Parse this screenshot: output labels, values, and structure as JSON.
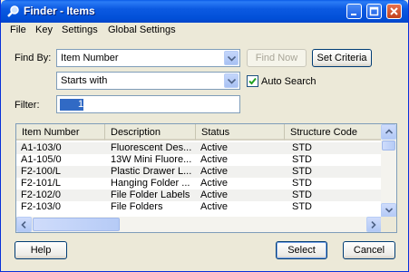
{
  "window": {
    "title": "Finder - Items"
  },
  "menu": [
    "File",
    "Key",
    "Settings",
    "Global Settings"
  ],
  "find_by": {
    "label": "Find By:",
    "field_value": "Item Number",
    "match_value": "Starts with",
    "find_now_label": "Find Now",
    "set_criteria_label": "Set Criteria",
    "auto_search_label": "Auto Search",
    "auto_search_checked": true
  },
  "filter": {
    "label": "Filter:",
    "value": "1"
  },
  "grid": {
    "columns": [
      "Item Number",
      "Description",
      "Status",
      "Structure Code"
    ],
    "rows": [
      [
        "A1-103/0",
        "Fluorescent Des...",
        "Active",
        "STD"
      ],
      [
        "A1-105/0",
        "13W Mini Fluore...",
        "Active",
        "STD"
      ],
      [
        "F2-100/L",
        "Plastic Drawer L...",
        "Active",
        "STD"
      ],
      [
        "F2-101/L",
        "Hanging Folder ...",
        "Active",
        "STD"
      ],
      [
        "F2-102/0",
        "File Folder Labels",
        "Active",
        "STD"
      ],
      [
        "F2-103/0",
        "File Folders",
        "Active",
        "STD"
      ]
    ]
  },
  "buttons": {
    "help": "Help",
    "select": "Select",
    "cancel": "Cancel"
  }
}
